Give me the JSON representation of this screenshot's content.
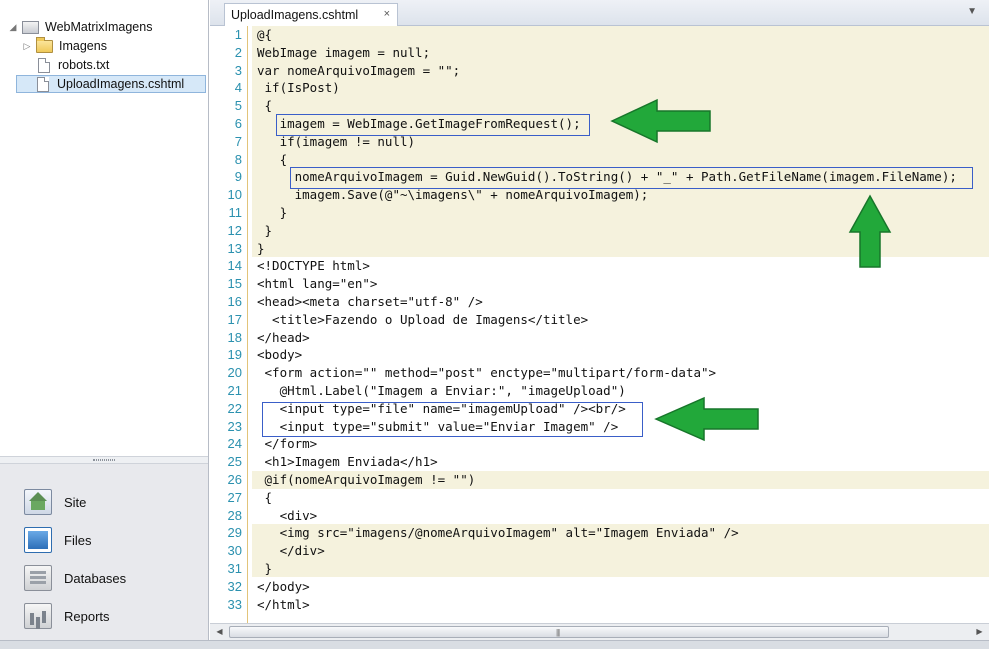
{
  "tree": {
    "root": "WebMatrixImagens",
    "items": [
      {
        "label": "Imagens",
        "icon": "folder-icon"
      },
      {
        "label": "robots.txt",
        "icon": "file-icon"
      },
      {
        "label": "UploadImagens.cshtml",
        "icon": "file-icon"
      }
    ]
  },
  "workspaces": [
    {
      "label": "Site",
      "icon": "site-icon"
    },
    {
      "label": "Files",
      "icon": "files-icon"
    },
    {
      "label": "Databases",
      "icon": "databases-icon"
    },
    {
      "label": "Reports",
      "icon": "reports-icon"
    }
  ],
  "editor": {
    "tab_title": "UploadImagens.cshtml",
    "tab_close": "×",
    "lines": [
      "@{",
      "WebImage imagem = null;",
      "var nomeArquivoImagem = \"\";",
      " if(IsPost)",
      " {",
      "   imagem = WebImage.GetImageFromRequest();",
      "   if(imagem != null)",
      "   {",
      "     nomeArquivoImagem = Guid.NewGuid().ToString() + \"_\" + Path.GetFileName(imagem.FileName);",
      "     imagem.Save(@\"~\\imagens\\\" + nomeArquivoImagem);",
      "   }",
      " }",
      "}",
      "<!DOCTYPE html>",
      "<html lang=\"en\">",
      "<head><meta charset=\"utf-8\" />",
      "  <title>Fazendo o Upload de Imagens</title>",
      "</head>",
      "<body>",
      " <form action=\"\" method=\"post\" enctype=\"multipart/form-data\">",
      "   @Html.Label(\"Imagem a Enviar:\", \"imageUpload\")",
      "   <input type=\"file\" name=\"imagemUpload\" /><br/>",
      "   <input type=\"submit\" value=\"Enviar Imagem\" />",
      " </form>",
      " <h1>Imagem Enviada</h1>",
      " @if(nomeArquivoImagem != \"\")",
      " {",
      "   <div>",
      "   <img src=\"imagens/@nomeArquivoImagem\" alt=\"Imagem Enviada\" />",
      "   </div>",
      " }",
      "</body>",
      "</html>"
    ],
    "colors": {
      "line_numbers": "#2b91af",
      "keyword": "#0000ff",
      "tag": "#a31515",
      "attribute": "#ff0000",
      "razor_highlight": "#f5f2dd",
      "annotation_arrow": "#22a83a",
      "annotation_box": "#3a5ec8"
    }
  }
}
